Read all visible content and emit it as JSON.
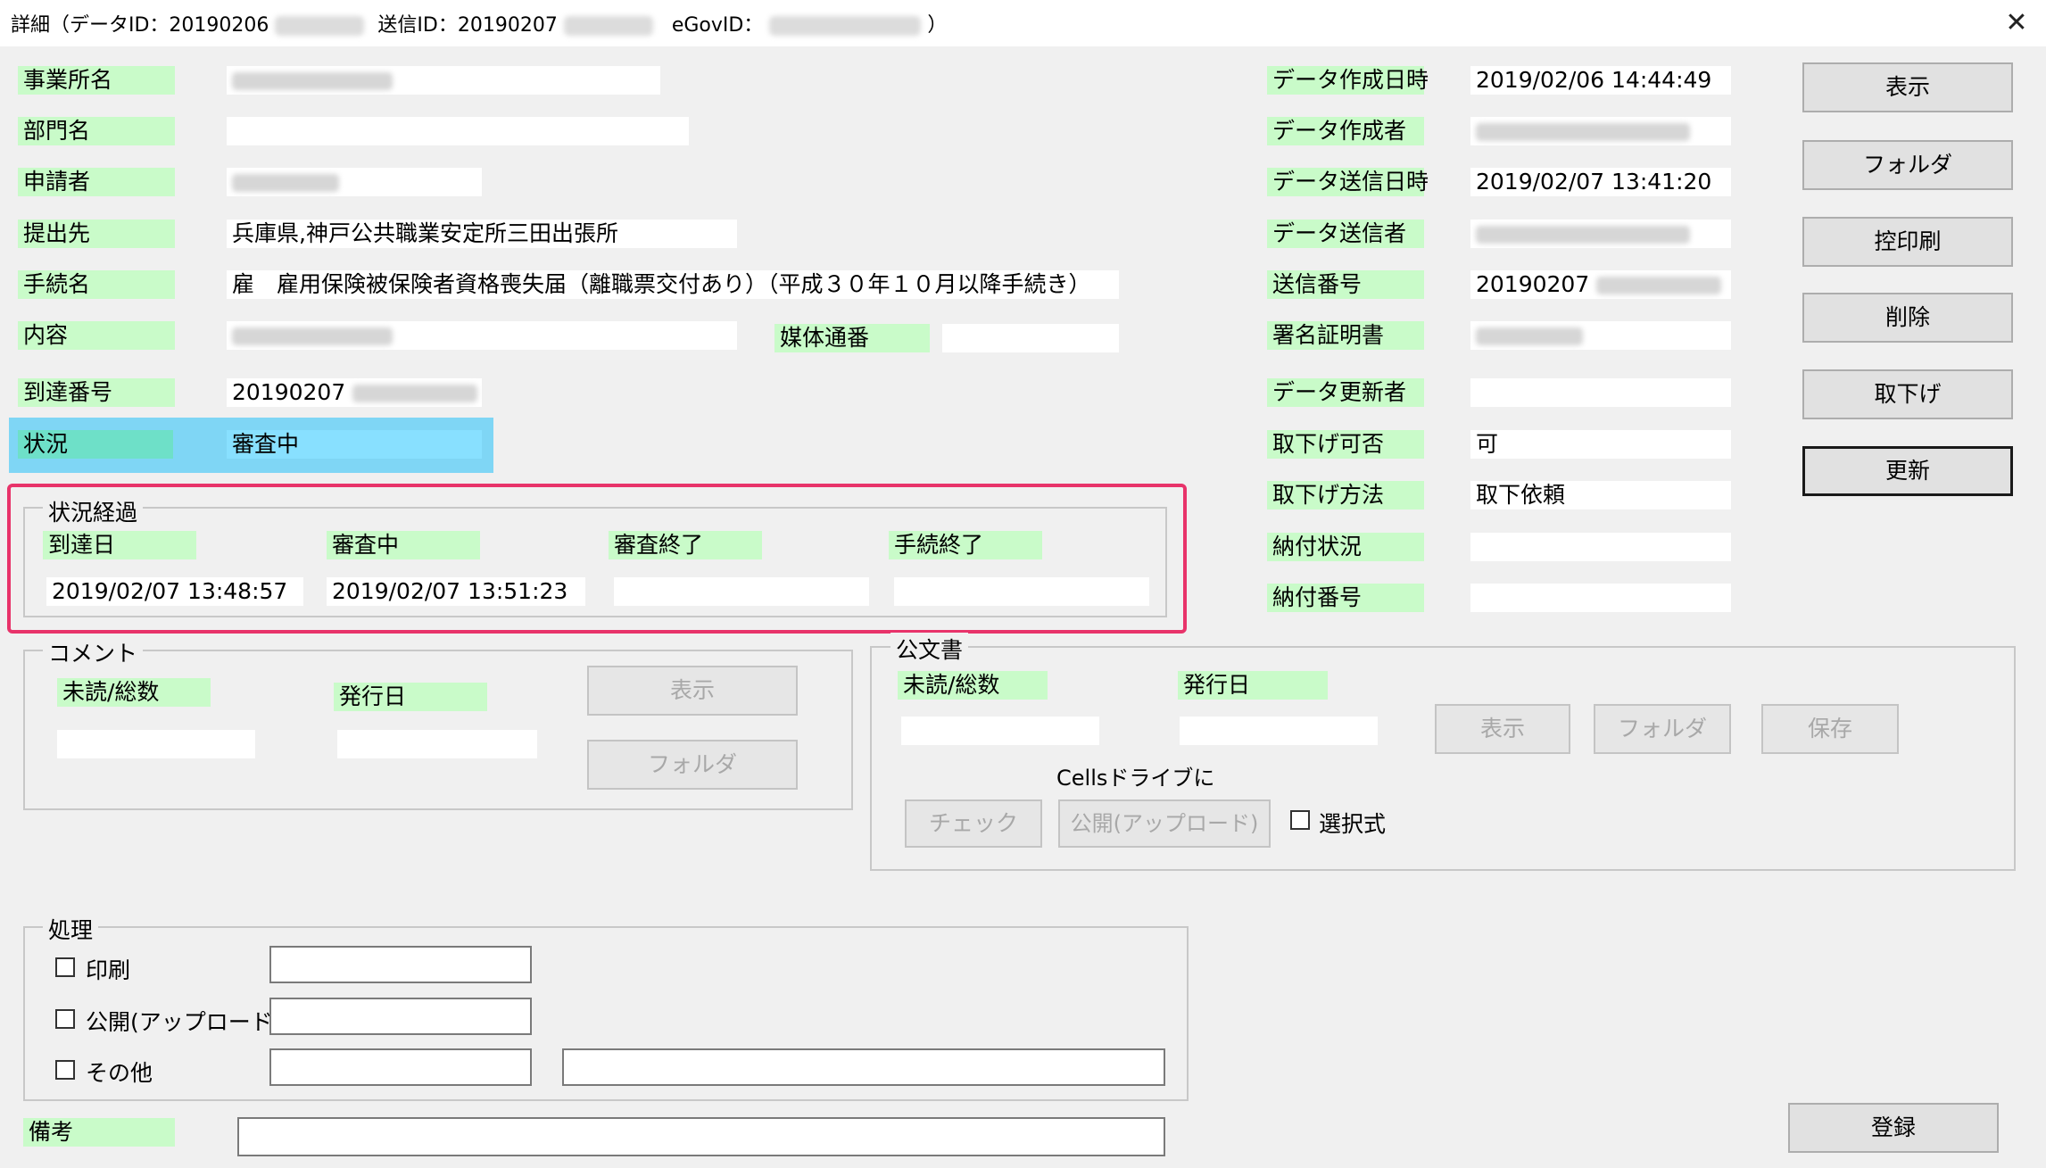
{
  "window": {
    "title_prefix": "詳細（データID：20190206",
    "title_mid1": "送信ID：20190207",
    "title_mid2": "eGovID：",
    "title_suffix": "）",
    "close_icon": "close-icon"
  },
  "left_fields": {
    "office_label": "事業所名",
    "dept_label": "部門名",
    "applicant_label": "申請者",
    "submit_to_label": "提出先",
    "submit_to_value": "兵庫県,神戸公共職業安定所三田出張所",
    "procedure_label": "手続名",
    "procedure_value": "雇　雇用保険被保険者資格喪失届（離職票交付あり）（平成３０年１０月以降手続き）",
    "content_label": "内容",
    "media_label": "媒体通番",
    "arrival_label": "到達番号",
    "arrival_value": "20190207",
    "status_label": "状況",
    "status_value": "審査中"
  },
  "progress": {
    "legend": "状況経過",
    "arrival_label": "到達日",
    "reviewing_label": "審査中",
    "review_done_label": "審査終了",
    "proc_done_label": "手続終了",
    "arrival_value": "2019/02/07 13:48:57",
    "reviewing_value": "2019/02/07 13:51:23"
  },
  "right_fields": {
    "created_at_label": "データ作成日時",
    "created_at_value": "2019/02/06 14:44:49",
    "creator_label": "データ作成者",
    "sent_at_label": "データ送信日時",
    "sent_at_value": "2019/02/07 13:41:20",
    "sender_label": "データ送信者",
    "send_no_label": "送信番号",
    "send_no_value": "20190207",
    "cert_label": "署名証明書",
    "updater_label": "データ更新者",
    "withdraw_ok_label": "取下げ可否",
    "withdraw_ok_value": "可",
    "withdraw_method_label": "取下げ方法",
    "withdraw_method_value": "取下依頼",
    "payment_status_label": "納付状況",
    "payment_no_label": "納付番号"
  },
  "side_buttons": {
    "show": "表示",
    "folder": "フォルダ",
    "print_copy": "控印刷",
    "delete": "削除",
    "withdraw": "取下げ",
    "update": "更新"
  },
  "comment": {
    "legend": "コメント",
    "unread_label": "未読/総数",
    "issued_label": "発行日",
    "show_button": "表示",
    "folder_button": "フォルダ"
  },
  "official_doc": {
    "legend": "公文書",
    "unread_label": "未読/総数",
    "issued_label": "発行日",
    "show_button": "表示",
    "folder_button": "フォルダ",
    "save_button": "保存",
    "cells_text": "Cellsドライブに",
    "check_button": "チェック",
    "upload_button": "公開(アップロード)",
    "select_label": "選択式"
  },
  "processing": {
    "legend": "処理",
    "print_label": "印刷",
    "upload_label": "公開(アップロード)",
    "other_label": "その他"
  },
  "remarks": {
    "label": "備考",
    "register_button": "登録"
  }
}
